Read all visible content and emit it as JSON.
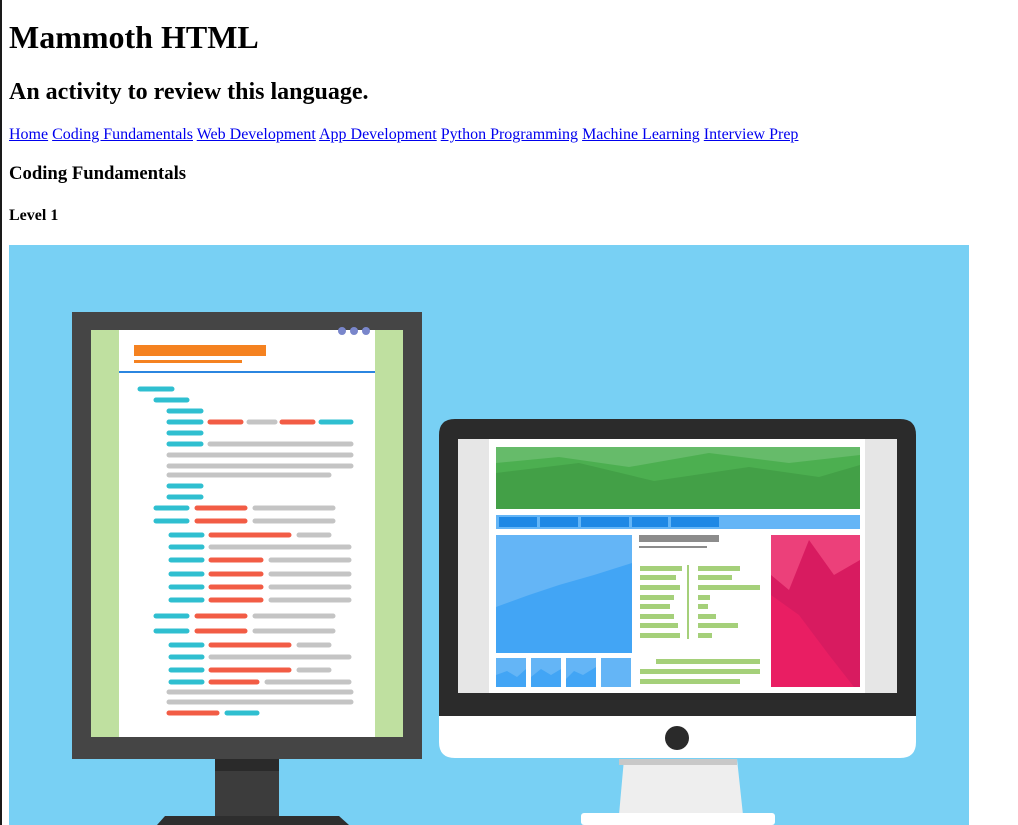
{
  "page": {
    "title": "Mammoth HTML",
    "subtitle": "An activity to review this language."
  },
  "nav": {
    "links": [
      {
        "label": "Home"
      },
      {
        "label": "Coding Fundamentals"
      },
      {
        "label": "Web Development"
      },
      {
        "label": "App Development"
      },
      {
        "label": "Python Programming"
      },
      {
        "label": "Machine Learning"
      },
      {
        "label": "Interview Prep"
      }
    ]
  },
  "section": {
    "heading": "Coding Fundamentals",
    "level": "Level 1"
  },
  "hero_image": {
    "icon": "code-editor-and-desktop-illustration",
    "colors": {
      "background": "#78d0f4",
      "monitor_frame": "#454545",
      "editor_sidebar": "#bfe0a0",
      "code_cyan": "#2fbfd0",
      "code_red": "#f25c45",
      "code_gray": "#c4c4c4",
      "header_orange": "#f58220",
      "banner_green": "#4caf50",
      "nav_blue": "#2b86e0",
      "chart_blue": "#42a5f5",
      "panel_pink": "#e91e63",
      "text_green": "#a5d07a"
    }
  }
}
